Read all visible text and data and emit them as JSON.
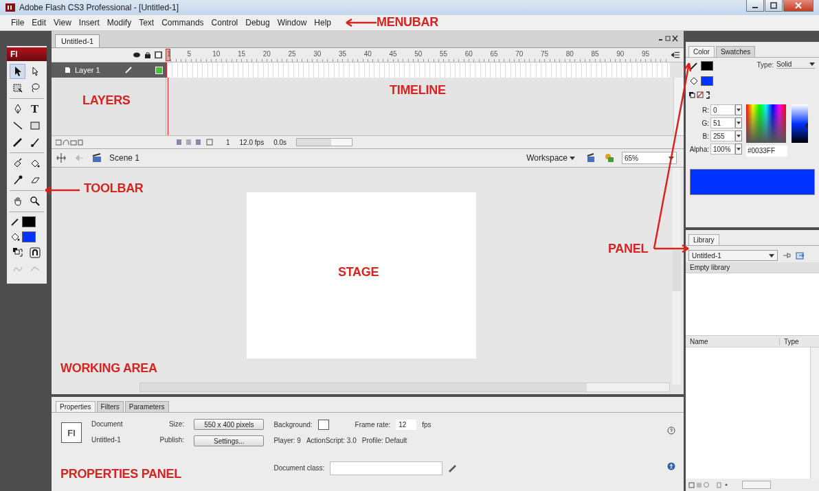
{
  "window": {
    "title": "Adobe Flash CS3 Professional - [Untitled-1]"
  },
  "menubar": [
    "File",
    "Edit",
    "View",
    "Insert",
    "Modify",
    "Text",
    "Commands",
    "Control",
    "Debug",
    "Window",
    "Help"
  ],
  "toolbar": {
    "logo": "Fl",
    "groups": [
      [
        {
          "kind": "arrow",
          "selected": true
        },
        {
          "kind": "hollow-arrow",
          "selected": false
        },
        {
          "kind": "transform",
          "selected": false
        },
        {
          "kind": "lasso",
          "selected": false
        }
      ],
      [
        {
          "kind": "pen",
          "selected": false
        },
        {
          "kind": "text",
          "glyph": "T",
          "selected": false
        },
        {
          "kind": "line",
          "selected": false
        },
        {
          "kind": "rectangle",
          "selected": false
        },
        {
          "kind": "pencil",
          "selected": false
        },
        {
          "kind": "brush",
          "selected": false
        }
      ],
      [
        {
          "kind": "bottle",
          "selected": false
        },
        {
          "kind": "bucket",
          "selected": false
        },
        {
          "kind": "eyedropper",
          "selected": false
        },
        {
          "kind": "eraser",
          "selected": false
        }
      ],
      [
        {
          "kind": "hand",
          "selected": false
        },
        {
          "kind": "zoom",
          "selected": false
        }
      ],
      [
        {
          "kind": "stroke-well",
          "color": "#000000"
        },
        {
          "kind": "fill-well",
          "color": "#0033ff"
        },
        {
          "kind": "swap"
        },
        {
          "kind": "snap"
        },
        {
          "kind": "smooth",
          "disabled": true
        },
        {
          "kind": "straighten",
          "disabled": true
        }
      ]
    ]
  },
  "document_tabs": [
    {
      "label": "Untitled-1",
      "selected": true
    }
  ],
  "timeline": {
    "frame_numbers": [
      "1",
      "5",
      "10",
      "15",
      "20",
      "25",
      "30",
      "35",
      "40",
      "45",
      "50",
      "55",
      "60",
      "65",
      "70",
      "75",
      "80",
      "85",
      "90",
      "95"
    ],
    "layers": [
      {
        "name": "Layer 1",
        "selected": true
      }
    ],
    "current_frame": "1",
    "frame_rate": "12.0 fps",
    "elapsed": "0.0s"
  },
  "edit_bar": {
    "scene": "Scene 1",
    "workspace": "Workspace",
    "zoom": "65%"
  },
  "properties": {
    "tabs": [
      {
        "label": "Properties",
        "selected": true
      },
      {
        "label": "Filters",
        "selected": false
      },
      {
        "label": "Parameters",
        "selected": false
      }
    ],
    "document_icon": "Fl",
    "document_label": "Document",
    "document_name": "Untitled-1",
    "size_label": "Size:",
    "size_button": "550 x 400 pixels",
    "publish_label": "Publish:",
    "settings_button": "Settings...",
    "background_label": "Background:",
    "frame_rate_label": "Frame rate:",
    "frame_rate": "12",
    "fps": "fps",
    "player": "Player: 9",
    "actionscript": "ActionScript: 3.0",
    "profile": "Profile: Default",
    "document_class_label": "Document class:"
  },
  "color_panel": {
    "tabs": [
      {
        "label": "Color",
        "selected": true
      },
      {
        "label": "Swatches",
        "selected": false
      }
    ],
    "wells": [
      {
        "kind": "stroke",
        "color": "#000000"
      },
      {
        "kind": "fill",
        "color": "#0033ff"
      }
    ],
    "type_label": "Type:",
    "type": "Solid",
    "channels": [
      {
        "label": "R:",
        "value": "0"
      },
      {
        "label": "G:",
        "value": "51"
      },
      {
        "label": "B:",
        "value": "255"
      },
      {
        "label": "Alpha:",
        "value": "100%"
      }
    ],
    "hex": "#0033FF",
    "preview": {
      "color": "#0033ff"
    }
  },
  "library_panel": {
    "tabs": [
      {
        "label": "Library",
        "selected": true
      }
    ],
    "document": "Untitled-1",
    "status": "Empty library",
    "columns": [
      "Name",
      "Type"
    ]
  },
  "annotations": {
    "menubar": "MENUBAR",
    "layers": "LAYERS",
    "timeline": "TIMELINE",
    "toolbar": "TOOLBAR",
    "stage": "STAGE",
    "working_area": "WORKING AREA",
    "properties_panel": "PROPERTIES PANEL",
    "panel": "PANEL"
  }
}
